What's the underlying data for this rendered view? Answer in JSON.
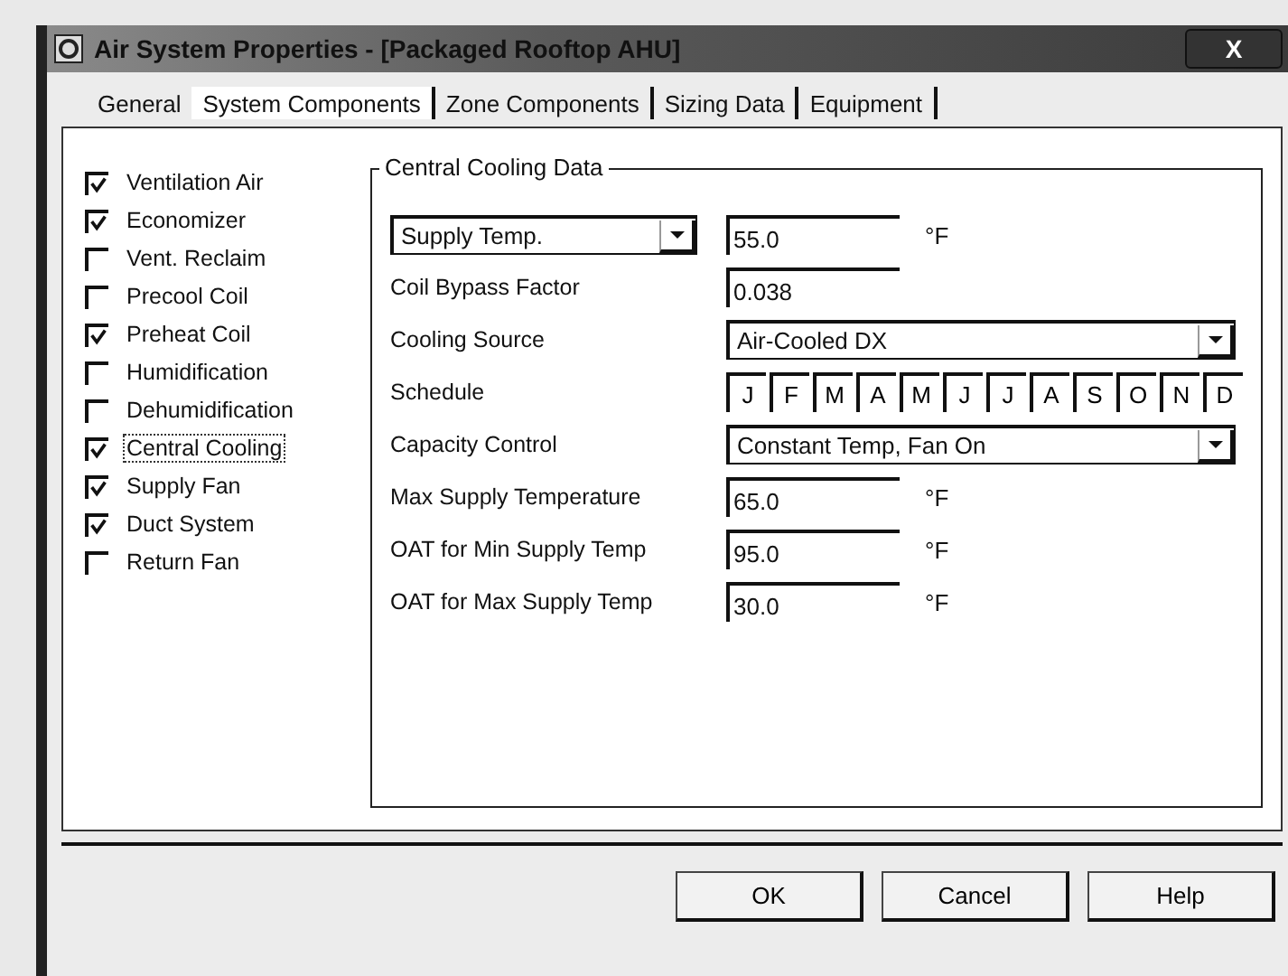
{
  "window": {
    "title": "Air System Properties - [Packaged Rooftop AHU]",
    "close": "X"
  },
  "tabs": [
    {
      "label": "General",
      "selected": false
    },
    {
      "label": "System Components",
      "selected": true
    },
    {
      "label": "Zone Components",
      "selected": false
    },
    {
      "label": "Sizing Data",
      "selected": false
    },
    {
      "label": "Equipment",
      "selected": false
    }
  ],
  "components": [
    {
      "label": "Ventilation Air",
      "checked": true,
      "focused": false
    },
    {
      "label": "Economizer",
      "checked": true,
      "focused": false
    },
    {
      "label": "Vent. Reclaim",
      "checked": false,
      "focused": false
    },
    {
      "label": "Precool Coil",
      "checked": false,
      "focused": false
    },
    {
      "label": "Preheat Coil",
      "checked": true,
      "focused": false
    },
    {
      "label": "Humidification",
      "checked": false,
      "focused": false
    },
    {
      "label": "Dehumidification",
      "checked": false,
      "focused": false
    },
    {
      "label": "Central Cooling",
      "checked": true,
      "focused": true
    },
    {
      "label": "Supply Fan",
      "checked": true,
      "focused": false
    },
    {
      "label": "Duct System",
      "checked": true,
      "focused": false
    },
    {
      "label": "Return Fan",
      "checked": false,
      "focused": false
    }
  ],
  "group": {
    "title": "Central Cooling Data",
    "rows": [
      {
        "kind": "select-input",
        "select": "Supply Temp.",
        "value": "55.0",
        "unit": "°F"
      },
      {
        "kind": "input",
        "label": "Coil Bypass Factor",
        "value": "0.038"
      },
      {
        "kind": "dropdown",
        "label": "Cooling Source",
        "value": "Air-Cooled DX"
      },
      {
        "kind": "schedule",
        "label": "Schedule",
        "months": [
          "J",
          "F",
          "M",
          "A",
          "M",
          "J",
          "J",
          "A",
          "S",
          "O",
          "N",
          "D"
        ]
      },
      {
        "kind": "dropdown",
        "label": "Capacity Control",
        "value": "Constant Temp, Fan On"
      },
      {
        "kind": "input",
        "label": "Max Supply Temperature",
        "value": "65.0",
        "unit": "°F"
      },
      {
        "kind": "input",
        "label": "OAT for Min Supply Temp",
        "value": "95.0",
        "unit": "°F"
      },
      {
        "kind": "input",
        "label": "OAT for Max Supply Temp",
        "value": "30.0",
        "unit": "°F"
      }
    ]
  },
  "buttons": [
    "OK",
    "Cancel",
    "Help"
  ]
}
